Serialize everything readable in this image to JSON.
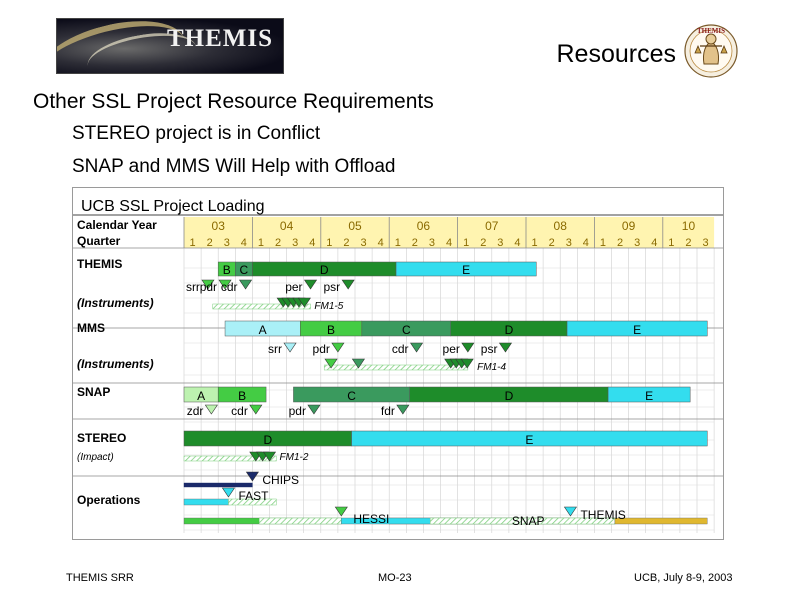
{
  "header": {
    "logo_text": "THEMIS",
    "title": "Resources",
    "badge_text": "THEMIS"
  },
  "slide": {
    "heading": "Other SSL Project Resource Requirements",
    "bullets": [
      "STEREO project is in Conflict",
      "SNAP and MMS Will Help with Offload"
    ]
  },
  "chart_data": {
    "type": "table",
    "title": "UCB SSL Project Loading",
    "row_header_calendar": "Calendar Year",
    "row_header_quarter": "Quarter",
    "years": [
      "03",
      "04",
      "05",
      "06",
      "07",
      "08",
      "09",
      "10"
    ],
    "quarters_per_year": [
      [
        "1",
        "2",
        "3",
        "4"
      ],
      [
        "1",
        "2",
        "3",
        "4"
      ],
      [
        "1",
        "2",
        "3",
        "4"
      ],
      [
        "1",
        "2",
        "3",
        "4"
      ],
      [
        "1",
        "2",
        "3",
        "4"
      ],
      [
        "1",
        "2",
        "3",
        "4"
      ],
      [
        "1",
        "2",
        "3",
        "4"
      ],
      [
        "1",
        "2",
        "3"
      ]
    ],
    "rows": [
      {
        "label": "THEMIS",
        "phases": [
          {
            "label": "B",
            "start": 2003.5,
            "end": 2003.75,
            "color": "#44cc44"
          },
          {
            "label": "C",
            "start": 2003.75,
            "end": 2004.0,
            "color": "#3a9a5e"
          },
          {
            "label": "D",
            "start": 2004.0,
            "end": 2006.1,
            "color": "#1e8c2a"
          },
          {
            "label": "E",
            "start": 2006.1,
            "end": 2008.15,
            "color": "#33ddee"
          }
        ],
        "milestones": [
          {
            "label": "srr",
            "t": 2003.35,
            "color": "#44cc44"
          },
          {
            "label": "pdr",
            "t": 2003.6,
            "color": "#44cc44"
          },
          {
            "label": "cdr",
            "t": 2003.9,
            "color": "#3a9a5e"
          },
          {
            "label": "per",
            "t": 2004.85,
            "color": "#1e8c2a"
          },
          {
            "label": "psr",
            "t": 2005.4,
            "color": "#1e8c2a"
          }
        ]
      },
      {
        "label": "(Instruments)",
        "italic": true,
        "hatch": {
          "start": 2003.42,
          "end": 2004.85
        },
        "milestones": [
          {
            "label": "",
            "t": 2004.45,
            "color": "#1e8c2a"
          },
          {
            "label": "",
            "t": 2004.52,
            "color": "#1e8c2a"
          },
          {
            "label": "",
            "t": 2004.6,
            "color": "#1e8c2a"
          },
          {
            "label": "",
            "t": 2004.68,
            "color": "#1e8c2a"
          },
          {
            "label": "",
            "t": 2004.76,
            "color": "#1e8c2a"
          }
        ],
        "note": "FM1-5"
      },
      {
        "label": "MMS",
        "phases": [
          {
            "label": "A",
            "start": 2003.6,
            "end": 2004.7,
            "color": "#aaf0f7"
          },
          {
            "label": "B",
            "start": 2004.7,
            "end": 2005.6,
            "color": "#44cc44"
          },
          {
            "label": "C",
            "start": 2005.6,
            "end": 2006.9,
            "color": "#3a9a5e"
          },
          {
            "label": "D",
            "start": 2006.9,
            "end": 2008.6,
            "color": "#1e8c2a"
          },
          {
            "label": "E",
            "start": 2008.6,
            "end": 2010.65,
            "color": "#33ddee"
          }
        ],
        "milestones": [
          {
            "label": "srr",
            "t": 2004.55,
            "color": "#aaf0f7"
          },
          {
            "label": "pdr",
            "t": 2005.25,
            "color": "#44cc44"
          },
          {
            "label": "cdr",
            "t": 2006.4,
            "color": "#3a9a5e"
          },
          {
            "label": "per",
            "t": 2007.15,
            "color": "#1e8c2a"
          },
          {
            "label": "psr",
            "t": 2007.7,
            "color": "#1e8c2a"
          }
        ]
      },
      {
        "label": "(Instruments)",
        "italic": true,
        "hatch": {
          "start": 2005.05,
          "end": 2007.15
        },
        "milestones": [
          {
            "label": "",
            "t": 2005.15,
            "color": "#44cc44"
          },
          {
            "label": "",
            "t": 2005.55,
            "color": "#3a9a5e"
          },
          {
            "label": "",
            "t": 2006.9,
            "color": "#1e8c2a"
          },
          {
            "label": "",
            "t": 2006.98,
            "color": "#1e8c2a"
          },
          {
            "label": "",
            "t": 2007.06,
            "color": "#1e8c2a"
          },
          {
            "label": "",
            "t": 2007.14,
            "color": "#1e8c2a"
          }
        ],
        "note": "FM1-4"
      },
      {
        "label": "SNAP",
        "phases": [
          {
            "label": "A",
            "start": 2003.0,
            "end": 2003.5,
            "color": "#bdf2b0"
          },
          {
            "label": "B",
            "start": 2003.5,
            "end": 2004.2,
            "color": "#44cc44"
          },
          {
            "label": "C",
            "start": 2004.6,
            "end": 2006.3,
            "color": "#3a9a5e"
          },
          {
            "label": "D",
            "start": 2006.3,
            "end": 2009.2,
            "color": "#1e8c2a"
          },
          {
            "label": "E",
            "start": 2009.2,
            "end": 2010.4,
            "color": "#33ddee"
          }
        ],
        "milestones": [
          {
            "label": "zdr",
            "t": 2003.4,
            "color": "#bdf2b0"
          },
          {
            "label": "cdr",
            "t": 2004.05,
            "color": "#44cc44"
          },
          {
            "label": "pdr",
            "t": 2004.9,
            "color": "#3a9a5e"
          },
          {
            "label": "fdr",
            "t": 2006.2,
            "color": "#3a9a5e"
          }
        ]
      },
      {
        "label": "STEREO",
        "sublabel": "(Impact)",
        "phases": [
          {
            "label": "D",
            "start": 2003.0,
            "end": 2005.45,
            "color": "#1e8c2a"
          },
          {
            "label": "E",
            "start": 2005.45,
            "end": 2010.65,
            "color": "#33ddee"
          }
        ],
        "hatch": {
          "start": 2003.0,
          "end": 2004.35
        },
        "milestones": [
          {
            "label": "",
            "t": 2004.05,
            "color": "#1e8c2a"
          },
          {
            "label": "",
            "t": 2004.15,
            "color": "#1e8c2a"
          },
          {
            "label": "",
            "t": 2004.25,
            "color": "#1e8c2a"
          }
        ],
        "note": "FM1-2"
      },
      {
        "label": "Operations",
        "ops": [
          {
            "label": "CHIPS",
            "start": 2003.0,
            "end": 2004.0,
            "color": "#1a2a6a",
            "marker_t": 2004.0,
            "marker_color": "#1a2a6a"
          },
          {
            "label": "FAST",
            "start": 2003.0,
            "end": 2003.65,
            "color": "#33ddee",
            "marker_t": 2003.65,
            "marker_color": "#33ddee",
            "hatch": {
              "start": 2003.65,
              "end": 2004.35
            }
          },
          {
            "label": "THEMIS",
            "start": 2006.0,
            "end": 2008.65,
            "color": "#33ddee",
            "marker_t": 2008.65,
            "marker_color": "#33ddee"
          },
          {
            "label": "HESSI",
            "start": 2003.0,
            "end": 2005.3,
            "color": "#44cc44",
            "marker_t": 2005.3,
            "marker_color": "#44cc44",
            "hatch": {
              "start": 2004.1,
              "end": 2005.3
            }
          },
          {
            "label": "SNAP",
            "start": 2005.3,
            "end": 2009.3,
            "color": "#33ddee",
            "hatch": {
              "start": 2006.6,
              "end": 2009.3
            }
          },
          {
            "label": "",
            "start": 2009.3,
            "end": 2010.65,
            "color": "#e0b830"
          }
        ]
      }
    ]
  },
  "footer": {
    "left": "THEMIS SRR",
    "center": "MO-23",
    "right": "UCB, July 8-9, 2003"
  }
}
